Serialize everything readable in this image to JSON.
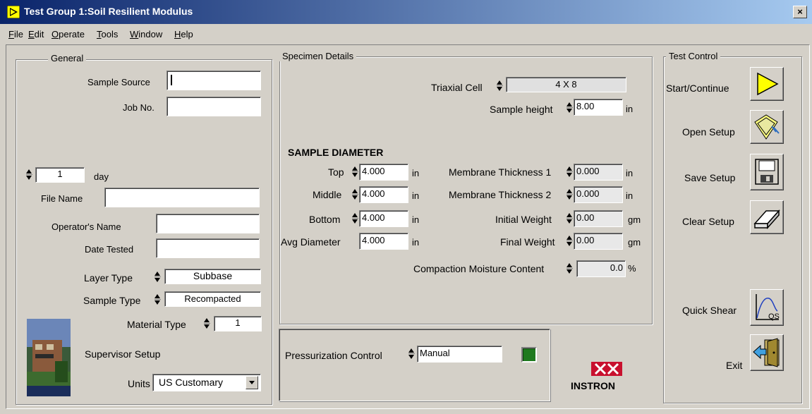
{
  "window": {
    "title": "Test Group 1:Soil Resilient Modulus",
    "close_glyph": "×"
  },
  "menu": [
    {
      "label": "File",
      "ul": "F",
      "rest": "ile"
    },
    {
      "label": "Edit",
      "ul": "E",
      "rest": "dit"
    },
    {
      "label": "Operate",
      "ul": "O",
      "rest": "perate"
    },
    {
      "label": "Tools",
      "ul": "T",
      "rest": "ools"
    },
    {
      "label": "Window",
      "ul": "W",
      "rest": "indow"
    },
    {
      "label": "Help",
      "ul": "H",
      "rest": "elp"
    }
  ],
  "general": {
    "legend": "General",
    "sample_source_label": "Sample Source",
    "sample_source_value": "",
    "job_no_label": "Job No.",
    "job_no_value": "",
    "day_value": "1",
    "day_label": "day",
    "file_name_label": "File Name",
    "file_name_value": "",
    "operator_label": "Operator's Name",
    "operator_value": "",
    "date_tested_label": "Date Tested",
    "date_tested_value": "",
    "layer_type_label": "Layer Type",
    "layer_type_value": "Subbase",
    "sample_type_label": "Sample Type",
    "sample_type_value": "Recompacted",
    "material_type_label": "Material Type",
    "material_type_value": "1",
    "supervisor_label": "Supervisor Setup",
    "units_label": "Units",
    "units_value": "US Customary"
  },
  "specimen": {
    "legend": "Specimen Details",
    "triaxial_cell_label": "Triaxial Cell",
    "triaxial_cell_value": "4 X 8",
    "sample_height_label": "Sample height",
    "sample_height_value": "8.00",
    "sample_height_unit": "in",
    "diameter_heading": "SAMPLE DIAMETER",
    "top_label": "Top",
    "top_value": "4.000",
    "middle_label": "Middle",
    "middle_value": "4.000",
    "bottom_label": "Bottom",
    "bottom_value": "4.000",
    "avg_label": "Avg Diameter",
    "avg_value": "4.000",
    "in_unit": "in",
    "membrane1_label": "Membrane Thickness 1",
    "membrane1_value": "0.000",
    "membrane2_label": "Membrane Thickness 2",
    "membrane2_value": "0.000",
    "initial_weight_label": "Initial Weight",
    "initial_weight_value": "0.00",
    "final_weight_label": "Final Weight",
    "final_weight_value": "0.00",
    "gm_unit": "gm",
    "moisture_label": "Compaction Moisture Content",
    "moisture_value": "0.0",
    "percent_unit": "%"
  },
  "pressurization": {
    "label": "Pressurization Control",
    "value": "Manual",
    "led_color": "#1f7a1f"
  },
  "brand": {
    "logo_text": "INSTRON"
  },
  "test_control": {
    "legend": "Test Control",
    "start_label": "Start/Continue",
    "open_label": "Open Setup",
    "save_label": "Save Setup",
    "clear_label": "Clear Setup",
    "quick_shear_label": "Quick Shear",
    "quick_shear_icon_text": "QS",
    "exit_label": "Exit"
  },
  "colors": {
    "titlebar_start": "#0a246a",
    "titlebar_end": "#a6caf0",
    "face": "#d4d0c8",
    "play_yellow": "#ffff00"
  }
}
